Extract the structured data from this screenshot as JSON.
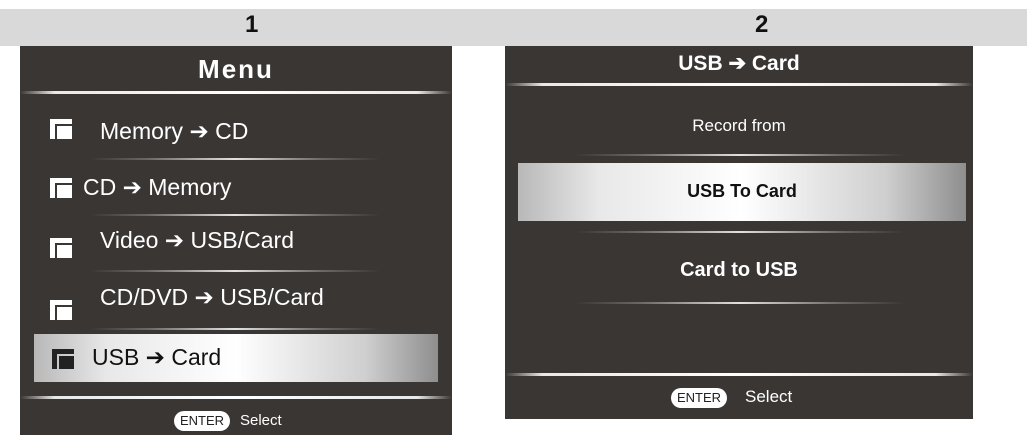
{
  "steps": [
    "1",
    "2"
  ],
  "menu_screen": {
    "title": "Menu",
    "items": [
      {
        "label": "Memory ➔ CD",
        "icon": "folder-icon",
        "selected": false
      },
      {
        "label": "CD ➔ Memory",
        "icon": "folder-icon",
        "selected": false
      },
      {
        "label": "Video ➔ USB/Card",
        "icon": "folder-icon",
        "selected": false
      },
      {
        "label": "CD/DVD ➔ USB/Card",
        "icon": "folder-icon",
        "selected": false
      },
      {
        "label": "USB ➔ Card",
        "icon": "folder-icon",
        "selected": true
      }
    ],
    "footer": {
      "enter_label": "ENTER",
      "select_label": "Select"
    }
  },
  "record_screen": {
    "title": "USB ➔ Card",
    "subtitle": "Record from",
    "options": [
      {
        "label": "USB To Card",
        "selected": true
      },
      {
        "label": "Card to USB",
        "selected": false
      }
    ],
    "footer": {
      "enter_label": "ENTER",
      "select_label": "Select"
    }
  },
  "colors": {
    "screen_bg": "#3a3634",
    "header_bar": "#d9d9d9",
    "text": "#ffffff"
  }
}
